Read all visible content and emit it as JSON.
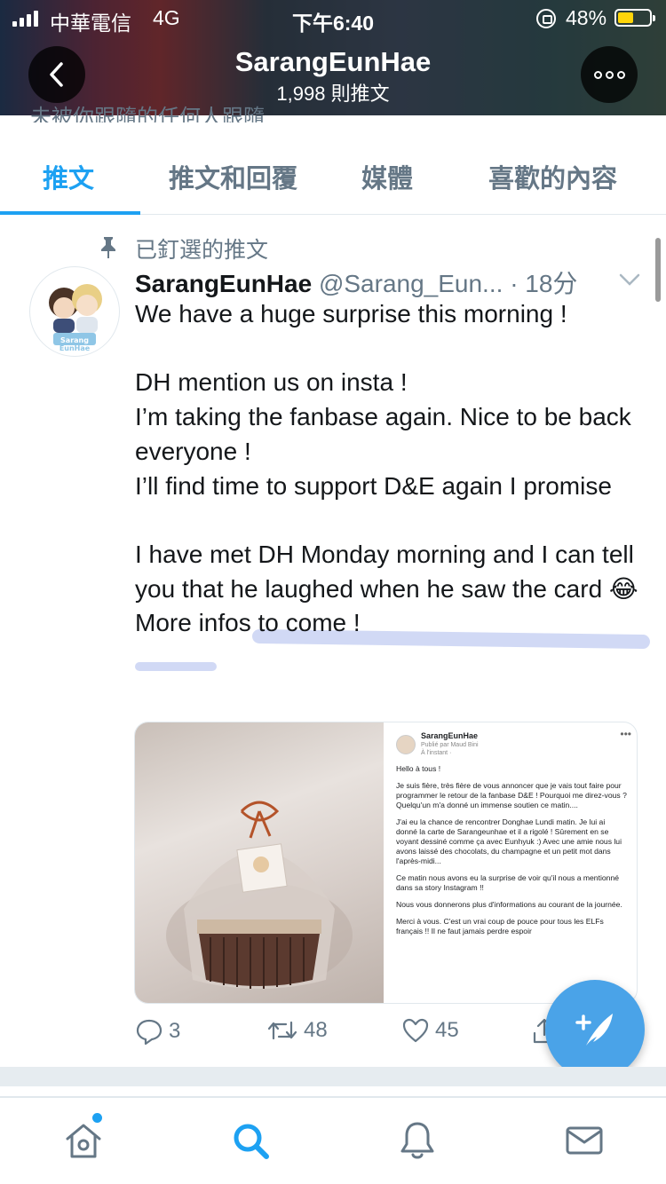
{
  "status_bar": {
    "carrier": "中華電信",
    "network": "4G",
    "time": "下午6:40",
    "battery": "48%"
  },
  "header": {
    "name": "SarangEunHae",
    "tweet_count": "1,998 則推文",
    "peek_text": "未被你跟隨的任何人跟隨"
  },
  "tabs": [
    "推文",
    "推文和回覆",
    "媒體",
    "喜歡的內容"
  ],
  "tweet": {
    "pinned_label": "已釘選的推文",
    "author_name": "SarangEunHae",
    "author_handle": "@Sarang_Eun...",
    "time": "· 18分",
    "text": "We have a huge surprise this morning !\n\nDH mention us on insta !\nI’m taking the fanbase again. Nice to be back everyone !\nI’ll find time to support D&E again I promise\n\nI have met DH Monday morning and I can tell you that he laughed when he saw the card 😂\nMore infos to come !",
    "avatar_text": "Sarang EunHae",
    "replies": "3",
    "retweets": "48",
    "likes": "45"
  },
  "media": {
    "doc_name": "SarangEunHae",
    "doc_published": "Publié par Maud Bini",
    "doc_time": "À l'instant · ",
    "doc_paragraphs": [
      "Hello à tous !",
      "Je suis fière, très fière de vous annoncer que je vais tout faire pour programmer le retour de la fanbase D&E ! Pourquoi me direz-vous ? Quelqu'un m'a donné un immense soutien ce matin....",
      "J'ai eu la chance de rencontrer Donghae Lundi matin. Je lui ai donné la carte de Sarangeunhae et il a rigolé ! Sûrement en se voyant dessiné comme ça avec Eunhyuk :) Avec une amie nous lui avons laissé des chocolats, du champagne et un petit mot dans l'après-midi...",
      "Ce matin nous avons eu la surprise de voir qu'il nous a mentionné dans sa story Instagram !!",
      "Nous vous donnerons plus d'informations au courant de la journée.",
      "Merci à vous. C'est un vrai coup de pouce pour tous les ELFs français !! Il ne faut jamais perdre espoir"
    ]
  },
  "icons": {
    "back": "chevron-left-icon",
    "more": "more-icon",
    "pin": "pin-icon",
    "reply": "reply-icon",
    "retweet": "retweet-icon",
    "like": "heart-icon",
    "share": "share-icon",
    "compose": "compose-tweet-icon",
    "home": "home-icon",
    "search": "search-icon",
    "notifications": "bell-icon",
    "messages": "mail-icon"
  },
  "colors": {
    "accent": "#1da1f2",
    "secondary_text": "#657786",
    "fab": "#4aa3e8"
  }
}
